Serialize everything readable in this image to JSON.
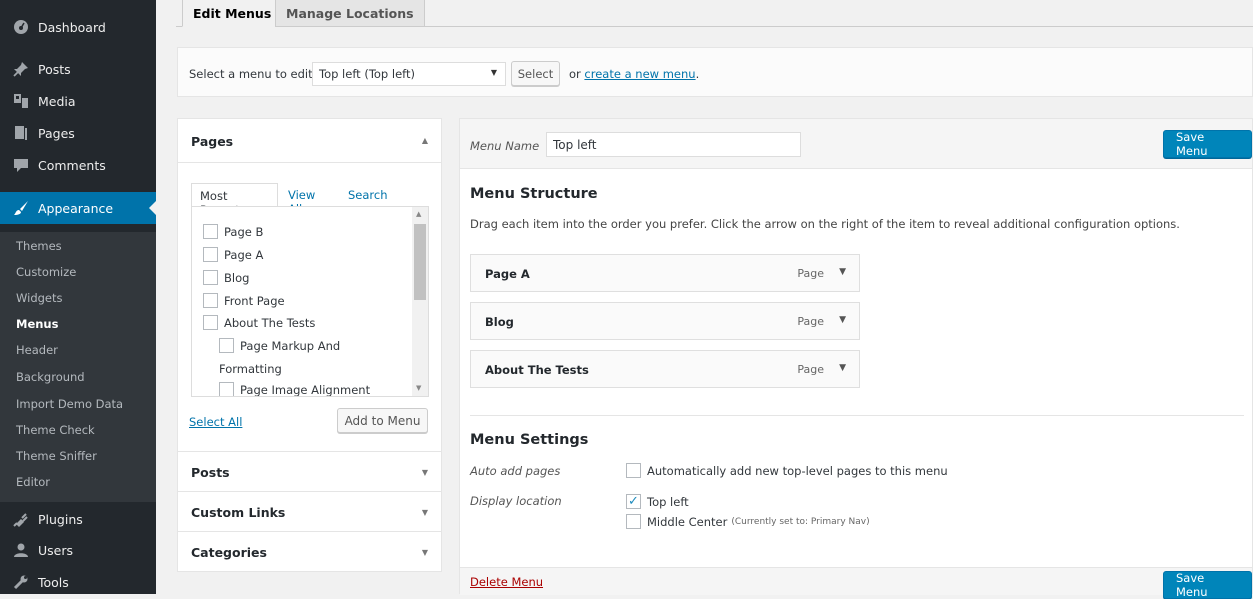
{
  "sidebar": {
    "items": [
      {
        "label": "Dashboard",
        "icon": "dashboard-icon"
      },
      {
        "label": "Posts",
        "icon": "pin-icon"
      },
      {
        "label": "Media",
        "icon": "media-icon"
      },
      {
        "label": "Pages",
        "icon": "page-icon"
      },
      {
        "label": "Comments",
        "icon": "comment-icon"
      },
      {
        "label": "Appearance",
        "icon": "paintbrush-icon"
      },
      {
        "label": "Plugins",
        "icon": "plug-icon"
      },
      {
        "label": "Users",
        "icon": "user-icon"
      },
      {
        "label": "Tools",
        "icon": "wrench-icon"
      }
    ],
    "submenu": [
      "Themes",
      "Customize",
      "Widgets",
      "Menus",
      "Header",
      "Background",
      "Import Demo Data",
      "Theme Check",
      "Theme Sniffer",
      "Editor"
    ],
    "active_item": "Appearance",
    "current_submenu": "Menus"
  },
  "tabs": [
    "Edit Menus",
    "Manage Locations"
  ],
  "manage": {
    "label": "Select a menu to edit:",
    "selected": "Top left (Top left)",
    "select_button": "Select",
    "or_text": "or",
    "create_link": "create a new menu",
    "period": "."
  },
  "accordion": {
    "pages": {
      "title": "Pages",
      "tabs": [
        "Most Recent",
        "View All",
        "Search"
      ],
      "items": [
        "Page B",
        "Page A",
        "Blog",
        "Front Page",
        "About The Tests",
        "Page Markup And",
        "Formatting",
        "Page Image Alignment"
      ],
      "select_all": "Select All",
      "add_button": "Add to Menu"
    },
    "sections": [
      "Posts",
      "Custom Links",
      "Categories"
    ]
  },
  "menu_editor": {
    "name_label": "Menu Name",
    "name_value": "Top left",
    "save_button": "Save Menu",
    "structure_title": "Menu Structure",
    "structure_help": "Drag each item into the order you prefer. Click the arrow on the right of the item to reveal additional configuration options.",
    "items": [
      {
        "title": "Page A",
        "type": "Page"
      },
      {
        "title": "Blog",
        "type": "Page"
      },
      {
        "title": "About The Tests",
        "type": "Page"
      }
    ],
    "settings_title": "Menu Settings",
    "auto_add_label": "Auto add pages",
    "auto_add_text": "Automatically add new top-level pages to this menu",
    "auto_add_checked": false,
    "display_label": "Display location",
    "locations": [
      {
        "name": "Top left",
        "note": "",
        "checked": true
      },
      {
        "name": "Middle Center",
        "note": "(Currently set to: Primary Nav)",
        "checked": false
      }
    ],
    "delete_link": "Delete Menu"
  },
  "colors": {
    "sidebar_bg": "#23282d",
    "active_blue": "#0073aa",
    "primary_button": "#0085ba",
    "delete_red": "#a00"
  }
}
